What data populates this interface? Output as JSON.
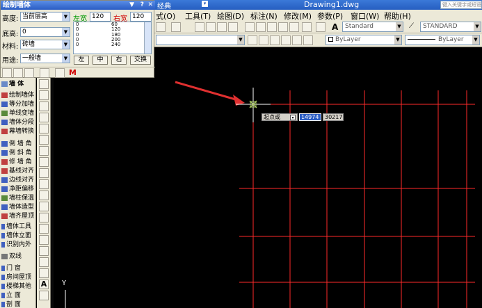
{
  "app": {
    "file_title": "Drawing1.dwg",
    "menu_partial": "经典",
    "search_placeholder": "键入关键字或短语"
  },
  "menus": [
    "式(O)",
    "工具(T)",
    "绘图(D)",
    "标注(N)",
    "修改(M)",
    "参数(P)",
    "窗口(W)",
    "帮助(H)"
  ],
  "toolbar": {
    "text_style": "Standard",
    "dim_style": "STANDARD",
    "color": "ByLayer",
    "linetype": "ByLayer"
  },
  "palette": {
    "title": "绘制墙体",
    "height_label": "高度:",
    "height_value": "当前层高",
    "base_label": "底高:",
    "base_value": "0",
    "material_label": "材料:",
    "material_value": "砖墙",
    "usage_label": "用途:",
    "usage_value": "一般墙",
    "left_width_label": "左宽",
    "left_width_value": "120",
    "right_width_label": "右宽",
    "right_width_value": "120",
    "width_list": [
      {
        "a": "0",
        "b": "60"
      },
      {
        "a": "0",
        "b": "120"
      },
      {
        "a": "0",
        "b": "180"
      },
      {
        "a": "0",
        "b": "200"
      },
      {
        "a": "0",
        "b": "240"
      }
    ],
    "btn_left": "左",
    "btn_center": "中",
    "btn_right": "右",
    "btn_swap": "交换"
  },
  "sidebar": {
    "header": "墙    体",
    "items": [
      "绘制墙体",
      "等分加墙",
      "单线变墙",
      "墙体分段",
      "幕墙转换",
      "倒 墙 角",
      "倒 斜 角",
      "修 墙 角",
      "基线对齐",
      "边线对齐",
      "净距偏移",
      "墙柱保温",
      "墙体造型",
      "墙齐屋顶",
      "墙体工具",
      "墙体立面",
      "识别内外",
      "双线",
      "门    窗",
      "房间屋顶",
      "楼梯其他",
      "立    面",
      "剖    面"
    ]
  },
  "canvas": {
    "ucs_label": "Y",
    "prompt_label": "起点或",
    "coord_x": "14974",
    "coord_y": "30217"
  },
  "colors": {
    "grid_line": "#ff2a2a",
    "arrow": "#e03030",
    "crosshair": "#ffffff",
    "cursor_center": "#a8c860"
  }
}
